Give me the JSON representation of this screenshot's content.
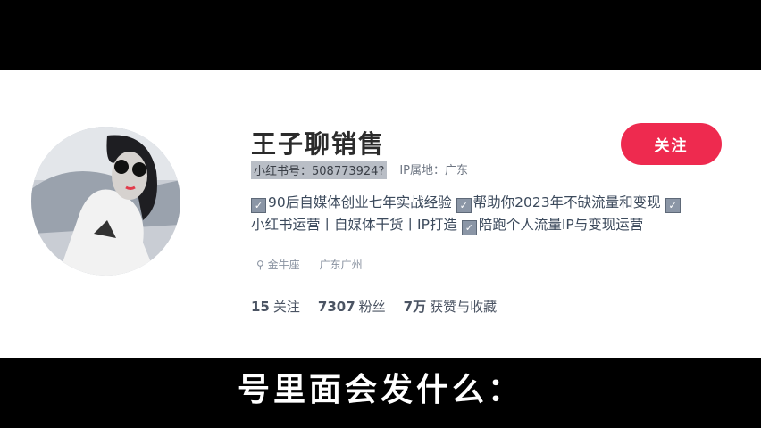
{
  "profile": {
    "username": "王子聊销售",
    "id_label": "小红书号：508773924?",
    "ip_label": "IP属地：广东",
    "follow_button": "关注",
    "bio": [
      {
        "check": "✓",
        "text": "90后自媒体创业七年实战经验"
      },
      {
        "check": "✓",
        "text": "帮助你2023年不缺流量和变现"
      },
      {
        "check": "✓",
        "text": "小红书运营丨自媒体干货丨IP打造"
      },
      {
        "check": "✓",
        "text": "陪跑个人流量IP与变现运营"
      }
    ],
    "tags": [
      "♀ 金牛座",
      "广东广州"
    ],
    "stats": {
      "following_count": "15",
      "following_label": "关注",
      "followers_count": "7307",
      "followers_label": "粉丝",
      "likes_count": "7万",
      "likes_label": "获赞与收藏"
    }
  },
  "subtitle": "号里面会发什么：",
  "colors": {
    "accent": "#ee2a4f"
  }
}
